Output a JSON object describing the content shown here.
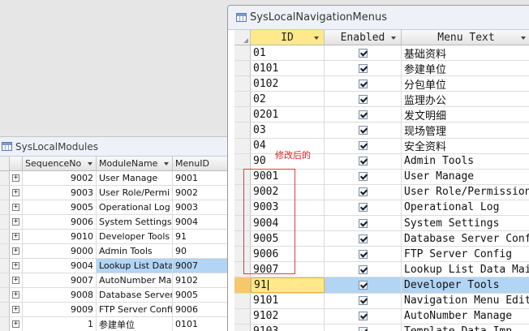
{
  "modules_window": {
    "title": "SysLocalModules",
    "columns": [
      "SequenceNo",
      "ModuleName",
      "MenuID"
    ],
    "rows": [
      {
        "seq": "9002",
        "name": "User Manage",
        "menu": "9001"
      },
      {
        "seq": "9003",
        "name": "User Role/Permi",
        "menu": "9002"
      },
      {
        "seq": "9005",
        "name": "Operational Log",
        "menu": "9003"
      },
      {
        "seq": "9006",
        "name": "System Settings",
        "menu": "9004"
      },
      {
        "seq": "9010",
        "name": "Developer Tools",
        "menu": "91"
      },
      {
        "seq": "9000",
        "name": "Admin Tools",
        "menu": "90"
      },
      {
        "seq": "9004",
        "name": "Lookup List Data",
        "menu": "9007"
      },
      {
        "seq": "9007",
        "name": "AutoNumber Ma",
        "menu": "9102"
      },
      {
        "seq": "9008",
        "name": "Database Server",
        "menu": "9005"
      },
      {
        "seq": "9009",
        "name": "FTP Server Config",
        "menu": "9006"
      },
      {
        "seq": "1",
        "name": "参建单位",
        "menu": "0101"
      }
    ],
    "selected_row": 6
  },
  "nav_window": {
    "title": "SysLocalNavigationMenus",
    "columns": [
      "ID",
      "Enabled",
      "Menu Text"
    ],
    "rows": [
      {
        "id": "01",
        "enabled": true,
        "text": "基础资料"
      },
      {
        "id": "0101",
        "enabled": true,
        "text": "参建单位"
      },
      {
        "id": "0102",
        "enabled": true,
        "text": "分包单位"
      },
      {
        "id": "02",
        "enabled": true,
        "text": "监理办公"
      },
      {
        "id": "0201",
        "enabled": true,
        "text": "发文明细"
      },
      {
        "id": "03",
        "enabled": true,
        "text": "现场管理"
      },
      {
        "id": "04",
        "enabled": true,
        "text": "安全资料"
      },
      {
        "id": "90",
        "enabled": true,
        "text": "Admin Tools"
      },
      {
        "id": "9001",
        "enabled": true,
        "text": "User Manage"
      },
      {
        "id": "9002",
        "enabled": true,
        "text": "User Role/Permission"
      },
      {
        "id": "9003",
        "enabled": true,
        "text": "Operational Log"
      },
      {
        "id": "9004",
        "enabled": true,
        "text": "System Settings"
      },
      {
        "id": "9005",
        "enabled": true,
        "text": "Database Server Conf"
      },
      {
        "id": "9006",
        "enabled": true,
        "text": "FTP Server Config"
      },
      {
        "id": "9007",
        "enabled": true,
        "text": "Lookup List Data Mai"
      },
      {
        "id": "91",
        "enabled": true,
        "text": "Developer Tools"
      },
      {
        "id": "9101",
        "enabled": true,
        "text": "Navigation Menu Edit"
      },
      {
        "id": "9102",
        "enabled": true,
        "text": "AutoNumber Manage"
      },
      {
        "id": "9103",
        "enabled": true,
        "text": "Template Data Imp"
      }
    ],
    "editing_row": 15
  },
  "annotation": {
    "label": "修改后的",
    "color": "#e02020"
  }
}
